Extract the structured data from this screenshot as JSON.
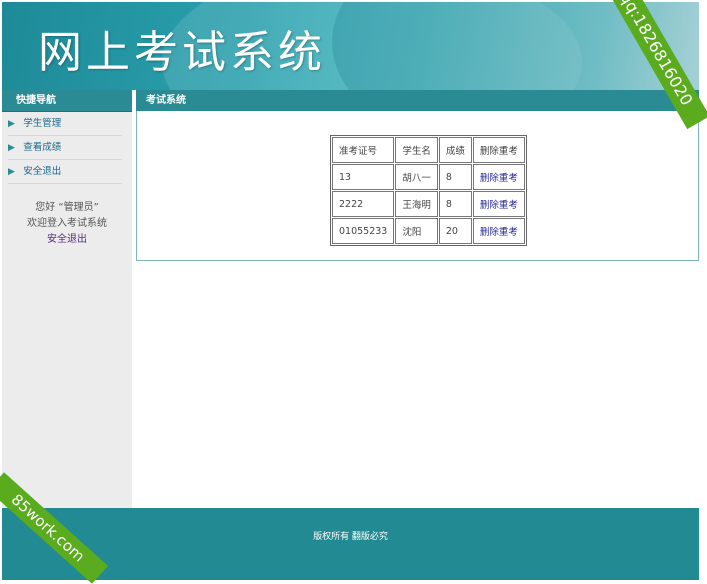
{
  "header": {
    "title": "网上考试系统"
  },
  "sidebar": {
    "heading": "快捷导航",
    "items": [
      {
        "label": "学生管理"
      },
      {
        "label": "查看成绩"
      },
      {
        "label": "安全退出"
      }
    ],
    "greeting_line1": "您好 “管理员”",
    "greeting_line2": "欢迎登入考试系统",
    "logout_link": "安全退出"
  },
  "content": {
    "heading": "考试系统",
    "table": {
      "columns": [
        "准考证号",
        "学生名",
        "成绩",
        "删除重考"
      ],
      "rows": [
        {
          "id": "13",
          "name": "胡八一",
          "score": "8",
          "action": "删除重考"
        },
        {
          "id": "2222",
          "name": "王海明",
          "score": "8",
          "action": "删除重考"
        },
        {
          "id": "01055233",
          "name": "沈阳",
          "score": "20",
          "action": "删除重考"
        }
      ]
    }
  },
  "footer": {
    "text": "版权所有 翻版必究"
  },
  "watermarks": {
    "top_right": "qq:1826816020",
    "bottom_left": "85work.com"
  },
  "colors": {
    "primary": "#2a8b94",
    "ribbon": "#5aab1e",
    "sidebar_bg": "#ececec"
  }
}
